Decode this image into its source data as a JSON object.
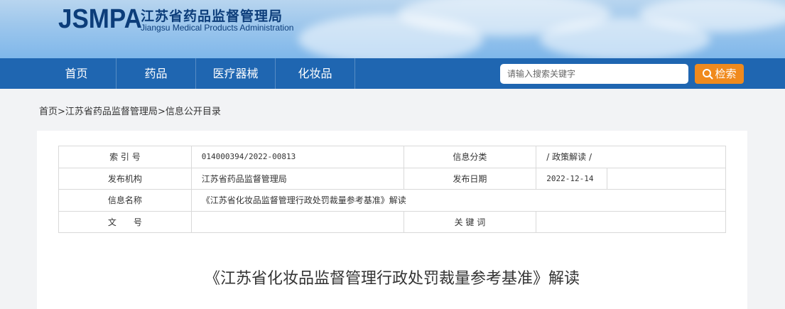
{
  "header": {
    "logo_mark": "JSMPA",
    "org_cn": "江苏省药品监督管理局",
    "org_en": "Jiangsu Medical Products Administration"
  },
  "nav": {
    "items": [
      {
        "label": "首页"
      },
      {
        "label": "药品"
      },
      {
        "label": "医疗器械"
      },
      {
        "label": "化妆品"
      }
    ],
    "search_placeholder": "请输入搜索关键字",
    "search_button": "检索"
  },
  "breadcrumb": {
    "items": [
      "首页",
      "江苏省药品监督管理局",
      "信息公开目录"
    ],
    "separator": ">"
  },
  "meta_table": {
    "index_label": "索 引 号",
    "index_value": "014000394/2022-00813",
    "category_label": "信息分类",
    "category_value": "/  政策解读  /",
    "publisher_label": "发布机构",
    "publisher_value": "江苏省药品监督管理局",
    "date_label": "发布日期",
    "date_value": "2022-12-14",
    "name_label": "信息名称",
    "name_value": "《江苏省化妆品监督管理行政处罚裁量参考基准》解读",
    "doc_no_label": "文　　号",
    "doc_no_value": "",
    "keywords_label": "关 键 词",
    "keywords_value": ""
  },
  "article": {
    "title": "《江苏省化妆品监督管理行政处罚裁量参考基准》解读"
  },
  "colors": {
    "nav_bg": "#1f66b1",
    "search_button": "#f08a1d",
    "logo": "#0c3d7a"
  }
}
